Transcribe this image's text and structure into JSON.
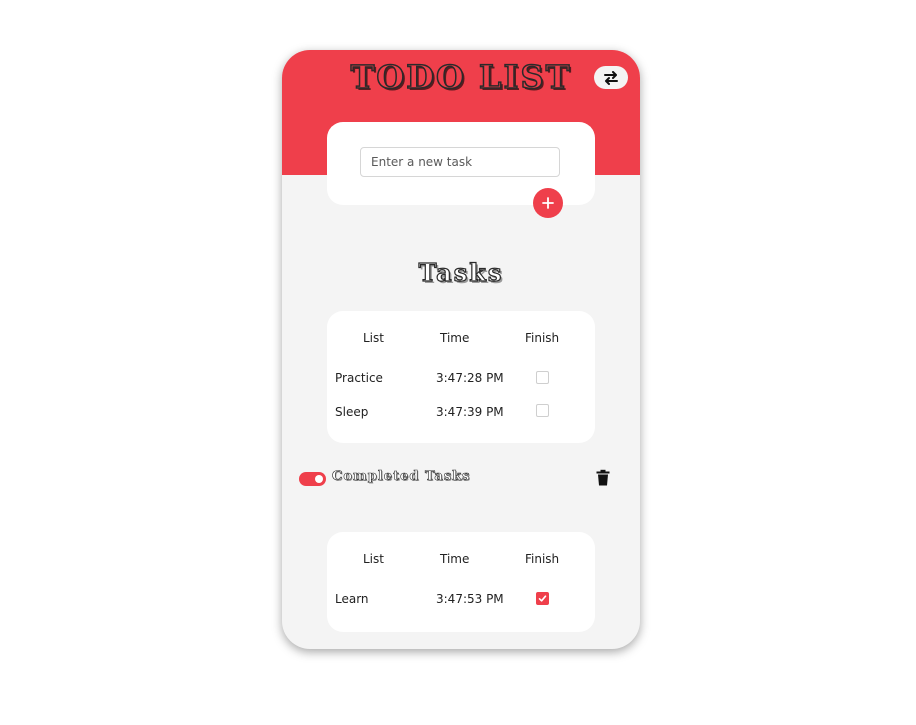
{
  "header": {
    "title": "TODO LIST",
    "swap_icon": "swap-arrows-icon"
  },
  "input": {
    "placeholder": "Enter a new task",
    "value": "",
    "add_icon": "plus-icon"
  },
  "tasks_section": {
    "title": "Tasks",
    "columns": [
      "List",
      "Time",
      "Finish"
    ],
    "rows": [
      {
        "name": "Practice",
        "time": "3:47:28 PM",
        "finished": false
      },
      {
        "name": "Sleep",
        "time": "3:47:39 PM",
        "finished": false
      }
    ]
  },
  "completed_section": {
    "label": "Completed Tasks",
    "toggle_on": true,
    "delete_icon": "trash-icon",
    "columns": [
      "List",
      "Time",
      "Finish"
    ],
    "rows": [
      {
        "name": "Learn",
        "time": "3:47:53 PM",
        "finished": true
      }
    ]
  },
  "colors": {
    "accent": "#ef3f4b",
    "background": "#f4f4f4",
    "card": "#ffffff"
  }
}
